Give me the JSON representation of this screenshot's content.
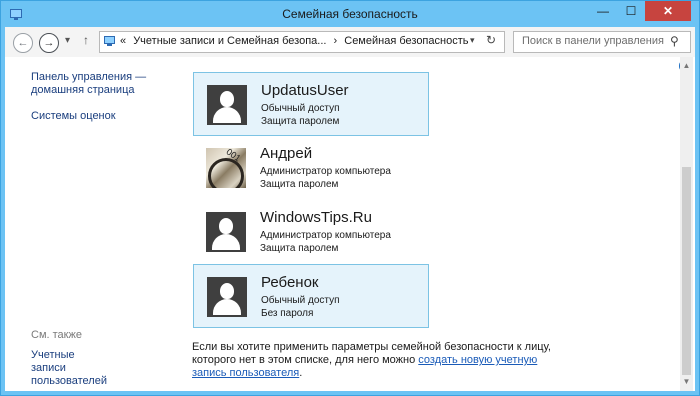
{
  "window": {
    "title": "Семейная безопасность",
    "minimize": "—",
    "maximize": "☐",
    "close": "✕"
  },
  "nav": {
    "back": "←",
    "forward": "→",
    "recent": "▾",
    "up": "↑",
    "breadcrumb_chevron": "«",
    "breadcrumbs": [
      "Учетные записи и Семейная безопа...",
      "›",
      "Семейная безопасность"
    ],
    "dropdown": "▾",
    "refresh": "↻",
    "search_placeholder": "Поиск в панели управления",
    "search_icon": "⚲"
  },
  "sidebar": {
    "links": [
      "Панель управления — домашняя страница",
      "Системы оценок"
    ],
    "see_also_title": "См. также",
    "see_also_links": [
      "Учетные записи пользователей"
    ]
  },
  "users": [
    {
      "name": "UpdatusUser",
      "role": "Обычный доступ",
      "password": "Защита паролем",
      "avatar": "default-user-icon",
      "selected": true
    },
    {
      "name": "Андрей",
      "role": "Администратор компьютера",
      "password": "Защита паролем",
      "avatar": "photo",
      "selected": false
    },
    {
      "name": "WindowsTips.Ru",
      "role": "Администратор компьютера",
      "password": "Защита паролем",
      "avatar": "default-user-icon",
      "selected": false
    },
    {
      "name": "Ребенок",
      "role": "Обычный доступ",
      "password": "Без пароля",
      "avatar": "default-user-icon",
      "selected": true
    }
  ],
  "photo_avatar_text": "001",
  "note": {
    "text": "Если вы хотите применить параметры семейной безопасности к лицу, которого нет в этом списке, для него можно ",
    "link": "создать новую учетную запись пользователя",
    "end": "."
  },
  "help": "?",
  "colors": {
    "titlebar": "#6cc3f4",
    "selected_bg": "#e5f3fb",
    "selected_border": "#7cc3e4",
    "link": "#1a5bb8"
  }
}
